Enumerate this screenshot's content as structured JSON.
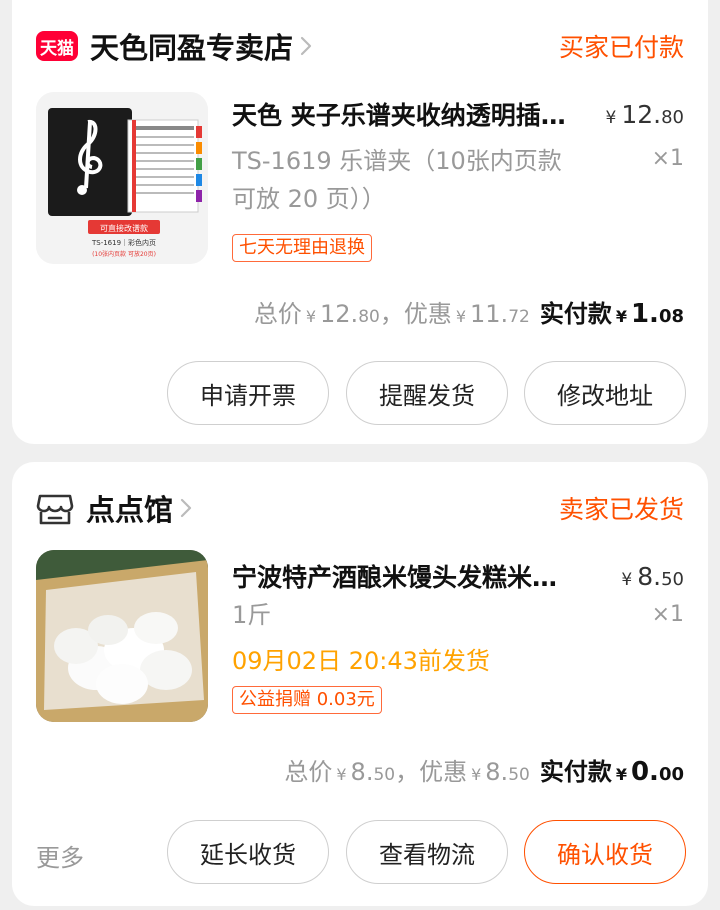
{
  "orders": [
    {
      "shop": {
        "logo_text": "天猫",
        "name": "天色同盈专卖店",
        "icon": "tmall-logo-icon"
      },
      "status": "买家已付款",
      "product": {
        "title": "天色 夹子乐谱夹收纳透明插…",
        "price_int": "12.",
        "price_dec": "80",
        "currency": "¥",
        "spec_line1": "TS-1619 乐谱夹（10张内页款",
        "spec_line2": "可放 20 页））",
        "qty": "×1",
        "tag": "七天无理由退换",
        "thumb_caption_top": "可直接改谱款",
        "thumb_caption_mid": "TS-1619｜彩色内页",
        "thumb_caption_bot": "(10张内页款 可放20页)"
      },
      "totals": {
        "total_label": "总价",
        "total_int": "12.",
        "total_dec": "80",
        "discount_label": "，优惠",
        "discount_int": "11.",
        "discount_dec": "72",
        "paid_label": "实付款",
        "paid_int": "1.",
        "paid_dec": "08",
        "currency": "¥"
      },
      "buttons": [
        "申请开票",
        "提醒发货",
        "修改地址"
      ]
    },
    {
      "shop": {
        "name": "点点馆",
        "icon": "store-icon"
      },
      "status": "卖家已发货",
      "product": {
        "title": "宁波特产酒酿米馒头发糕米…",
        "price_int": "8.",
        "price_dec": "50",
        "currency": "¥",
        "spec_line1": "1斤",
        "qty": "×1",
        "ship_time": "09月02日 20:43前发货",
        "tag": "公益捐赠 0.03元"
      },
      "totals": {
        "total_label": "总价",
        "total_int": "8.",
        "total_dec": "50",
        "discount_label": "，优惠",
        "discount_int": "8.",
        "discount_dec": "50",
        "paid_label": "实付款",
        "paid_int": "0.",
        "paid_dec": "00",
        "currency": "¥"
      },
      "more_label": "更多",
      "buttons": [
        "延长收货",
        "查看物流",
        "确认收货"
      ]
    }
  ],
  "colors": {
    "accent": "#ff5000",
    "tmall_red": "#ff0036",
    "ship_time": "#ffa200"
  }
}
